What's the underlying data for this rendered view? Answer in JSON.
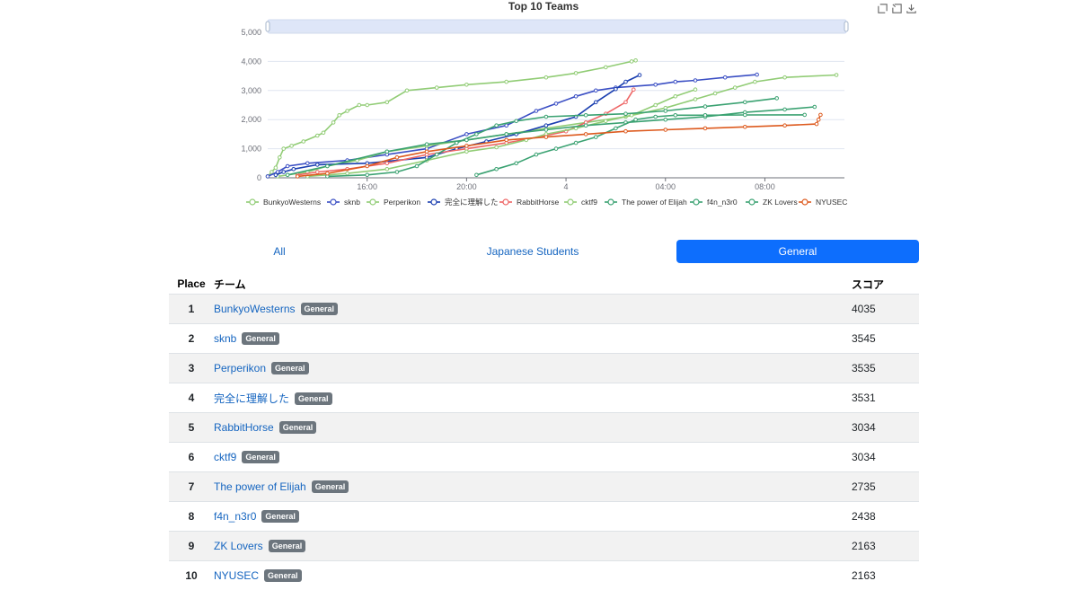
{
  "chart_data": {
    "type": "line",
    "title": "Top 10 Teams",
    "y_ticks": [
      "0",
      "1,000",
      "2,000",
      "3,000",
      "4,000",
      "5,000"
    ],
    "x_ticks": [
      "16:00",
      "20:00",
      "4",
      "04:00",
      "08:00"
    ],
    "ylim": [
      0,
      5000
    ],
    "grid": "horizontal",
    "legend_position": "bottom",
    "series": [
      {
        "name": "BunkyoWesterns",
        "color": "#91cc75",
        "points": [
          [
            0,
            50
          ],
          [
            0.2,
            200
          ],
          [
            0.4,
            350
          ],
          [
            0.6,
            700
          ],
          [
            0.8,
            1000
          ],
          [
            1.2,
            1100
          ],
          [
            1.8,
            1250
          ],
          [
            2.5,
            1450
          ],
          [
            2.8,
            1550
          ],
          [
            3.3,
            1900
          ],
          [
            3.6,
            2150
          ],
          [
            4.0,
            2300
          ],
          [
            4.6,
            2500
          ],
          [
            5.0,
            2500
          ],
          [
            6.0,
            2600
          ],
          [
            7.0,
            3000
          ],
          [
            8.5,
            3100
          ],
          [
            10,
            3200
          ],
          [
            12,
            3300
          ],
          [
            14,
            3450
          ],
          [
            15.5,
            3600
          ],
          [
            17,
            3800
          ],
          [
            18.3,
            4000
          ],
          [
            18.5,
            4035
          ]
        ]
      },
      {
        "name": "sknb",
        "color": "#3b4fc4",
        "points": [
          [
            0,
            50
          ],
          [
            0.5,
            200
          ],
          [
            1.0,
            400
          ],
          [
            2.0,
            500
          ],
          [
            4.0,
            600
          ],
          [
            6.0,
            800
          ],
          [
            8.0,
            1000
          ],
          [
            10,
            1500
          ],
          [
            12,
            1800
          ],
          [
            13.5,
            2300
          ],
          [
            14.5,
            2550
          ],
          [
            15.5,
            2800
          ],
          [
            16.5,
            3000
          ],
          [
            17.5,
            3100
          ],
          [
            19.5,
            3200
          ],
          [
            20.5,
            3300
          ],
          [
            21.5,
            3350
          ],
          [
            23,
            3450
          ],
          [
            24.6,
            3545
          ]
        ]
      },
      {
        "name": "Perperikon",
        "color": "#91cc75",
        "points": [
          [
            0.5,
            50
          ],
          [
            1.0,
            100
          ],
          [
            2.0,
            200
          ],
          [
            3.0,
            400
          ],
          [
            4.5,
            600
          ],
          [
            6.0,
            900
          ],
          [
            8.0,
            1100
          ],
          [
            10,
            1300
          ],
          [
            12,
            1500
          ],
          [
            14,
            1700
          ],
          [
            16,
            1900
          ],
          [
            18,
            2100
          ],
          [
            20,
            2400
          ],
          [
            21.5,
            2700
          ],
          [
            22.5,
            2900
          ],
          [
            23.5,
            3100
          ],
          [
            24.5,
            3300
          ],
          [
            26,
            3450
          ],
          [
            28.6,
            3535
          ]
        ]
      },
      {
        "name": "完全に理解した",
        "color": "#1b3fb0",
        "points": [
          [
            0.4,
            100
          ],
          [
            0.8,
            200
          ],
          [
            1.3,
            300
          ],
          [
            2.5,
            450
          ],
          [
            5,
            500
          ],
          [
            8,
            700
          ],
          [
            9.5,
            1000
          ],
          [
            11,
            1250
          ],
          [
            12.5,
            1500
          ],
          [
            14,
            1800
          ],
          [
            15.5,
            2100
          ],
          [
            16.5,
            2600
          ],
          [
            17.5,
            3050
          ],
          [
            18,
            3300
          ],
          [
            18.7,
            3531
          ]
        ]
      },
      {
        "name": "RabbitHorse",
        "color": "#ee6666",
        "points": [
          [
            1.5,
            100
          ],
          [
            2.5,
            200
          ],
          [
            4.0,
            300
          ],
          [
            6.0,
            500
          ],
          [
            8.0,
            800
          ],
          [
            10,
            1000
          ],
          [
            12,
            1200
          ],
          [
            14,
            1450
          ],
          [
            15,
            1600
          ],
          [
            16,
            1900
          ],
          [
            17,
            2200
          ],
          [
            18,
            2600
          ],
          [
            18.4,
            3034
          ]
        ]
      },
      {
        "name": "cktf9",
        "color": "#91cc75",
        "points": [
          [
            2.0,
            50
          ],
          [
            4.0,
            150
          ],
          [
            6.0,
            300
          ],
          [
            8.0,
            600
          ],
          [
            10,
            900
          ],
          [
            11.5,
            1050
          ],
          [
            13,
            1300
          ],
          [
            14,
            1500
          ],
          [
            15.5,
            1700
          ],
          [
            17,
            1950
          ],
          [
            18.3,
            2150
          ],
          [
            19.5,
            2500
          ],
          [
            20.5,
            2800
          ],
          [
            21.5,
            3034
          ]
        ]
      },
      {
        "name": "The power of Elijah",
        "color": "#3ba272",
        "points": [
          [
            3.0,
            50
          ],
          [
            5.0,
            100
          ],
          [
            6.5,
            200
          ],
          [
            7.5,
            400
          ],
          [
            8.5,
            800
          ],
          [
            9.5,
            1200
          ],
          [
            10.5,
            1500
          ],
          [
            11.5,
            1800
          ],
          [
            12.5,
            1950
          ],
          [
            14,
            2100
          ],
          [
            16,
            2150
          ],
          [
            18,
            2200
          ],
          [
            20,
            2300
          ],
          [
            22,
            2450
          ],
          [
            24,
            2600
          ],
          [
            25.6,
            2735
          ]
        ]
      },
      {
        "name": "f4n_n3r0",
        "color": "#3ba272",
        "points": [
          [
            1.0,
            100
          ],
          [
            3.0,
            400
          ],
          [
            6.0,
            900
          ],
          [
            8.0,
            1150
          ],
          [
            10,
            1300
          ],
          [
            12,
            1500
          ],
          [
            14,
            1650
          ],
          [
            16,
            1800
          ],
          [
            18,
            1900
          ],
          [
            20,
            2000
          ],
          [
            22,
            2100
          ],
          [
            24,
            2250
          ],
          [
            26,
            2350
          ],
          [
            27.5,
            2438
          ]
        ]
      },
      {
        "name": "ZK Lovers",
        "color": "#3ba272",
        "points": [
          [
            10.5,
            100
          ],
          [
            11.5,
            300
          ],
          [
            12.5,
            500
          ],
          [
            13.5,
            800
          ],
          [
            14.5,
            1000
          ],
          [
            15.5,
            1200
          ],
          [
            16.5,
            1400
          ],
          [
            17.5,
            1700
          ],
          [
            18.5,
            2000
          ],
          [
            19.5,
            2100
          ],
          [
            20.5,
            2150
          ],
          [
            22,
            2150
          ],
          [
            24,
            2160
          ],
          [
            27,
            2163
          ]
        ]
      },
      {
        "name": "NYUSEC",
        "color": "#dd5a1e",
        "points": [
          [
            1.5,
            50
          ],
          [
            3,
            150
          ],
          [
            5,
            400
          ],
          [
            6.5,
            700
          ],
          [
            8,
            900
          ],
          [
            10,
            1100
          ],
          [
            12,
            1300
          ],
          [
            14,
            1400
          ],
          [
            16,
            1500
          ],
          [
            18,
            1600
          ],
          [
            20,
            1650
          ],
          [
            22,
            1700
          ],
          [
            24,
            1750
          ],
          [
            26,
            1800
          ],
          [
            27.6,
            1850
          ],
          [
            27.7,
            2000
          ],
          [
            27.8,
            2163
          ]
        ]
      }
    ]
  },
  "tabs": [
    {
      "label": "All",
      "active": false
    },
    {
      "label": "Japanese Students",
      "active": false
    },
    {
      "label": "General",
      "active": true
    }
  ],
  "table": {
    "headers": {
      "place": "Place",
      "team": "チーム",
      "score": "スコア"
    },
    "rows": [
      {
        "place": "1",
        "team": "BunkyoWesterns",
        "badge": "General",
        "score": "4035"
      },
      {
        "place": "2",
        "team": "sknb",
        "badge": "General",
        "score": "3545"
      },
      {
        "place": "3",
        "team": "Perperikon",
        "badge": "General",
        "score": "3535"
      },
      {
        "place": "4",
        "team": "完全に理解した",
        "badge": "General",
        "score": "3531"
      },
      {
        "place": "5",
        "team": "RabbitHorse",
        "badge": "General",
        "score": "3034"
      },
      {
        "place": "6",
        "team": "cktf9",
        "badge": "General",
        "score": "3034"
      },
      {
        "place": "7",
        "team": "The power of Elijah",
        "badge": "General",
        "score": "2735"
      },
      {
        "place": "8",
        "team": "f4n_n3r0",
        "badge": "General",
        "score": "2438"
      },
      {
        "place": "9",
        "team": "ZK Lovers",
        "badge": "General",
        "score": "2163"
      },
      {
        "place": "10",
        "team": "NYUSEC",
        "badge": "General",
        "score": "2163"
      }
    ]
  },
  "toolbar": {
    "icons": [
      "zoom-icon",
      "zoom-reset-icon",
      "download-icon"
    ]
  }
}
